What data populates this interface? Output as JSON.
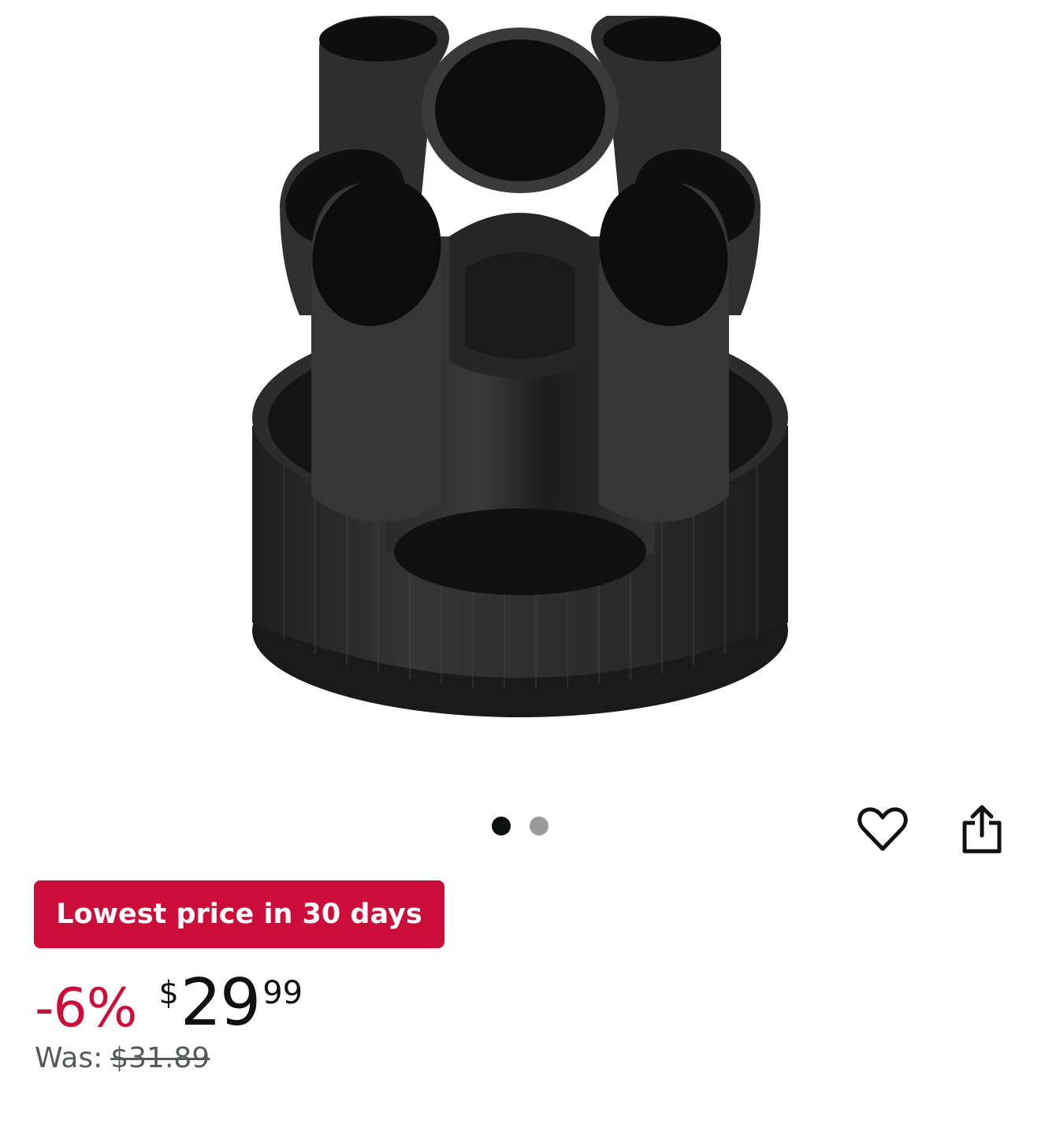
{
  "product": {
    "image_alt": "Black rotating desk organizer",
    "carousel": {
      "count": 2,
      "active_index": 0
    },
    "icons": {
      "wishlist": "heart-outline-icon",
      "share": "share-upload-icon"
    }
  },
  "deal": {
    "badge_label": "Lowest price in 30 days",
    "badge_color": "#cc0c39"
  },
  "price": {
    "discount": "-6%",
    "currency_symbol": "$",
    "whole": "29",
    "fraction": "99",
    "was_label": "Was:",
    "was_value": "$31.89"
  }
}
